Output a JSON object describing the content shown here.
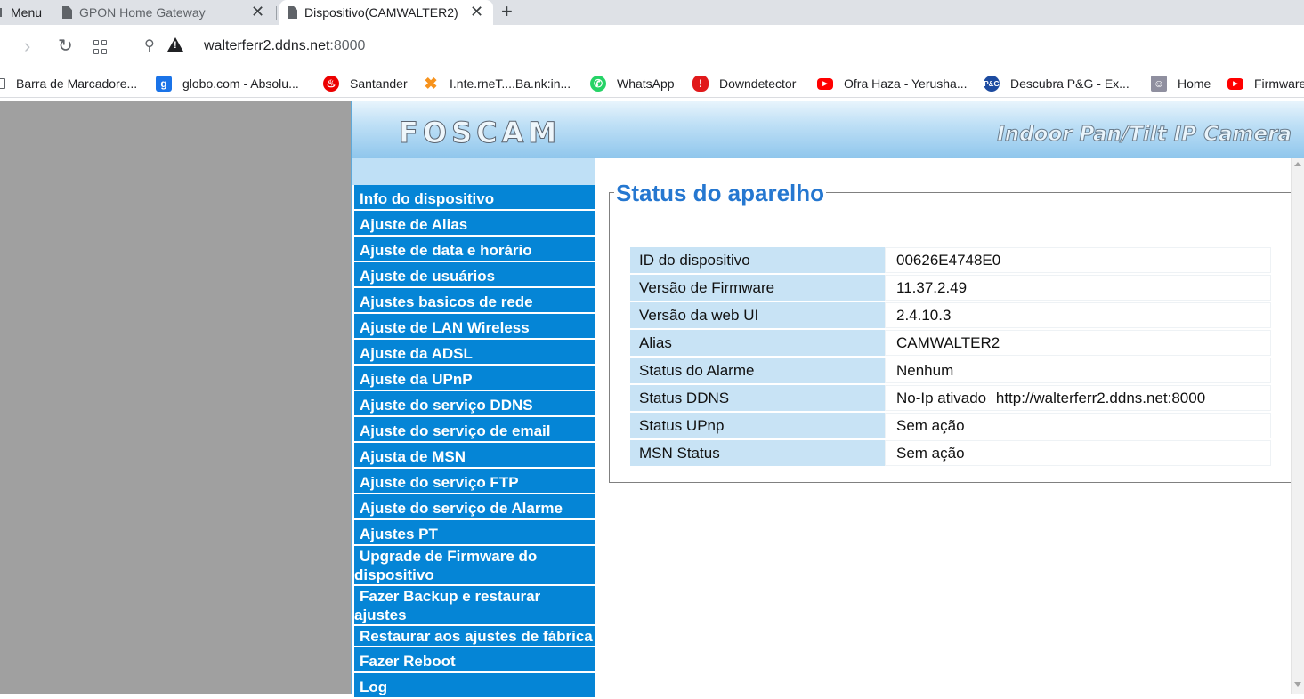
{
  "browser": {
    "menu_label": "Menu",
    "tabs": [
      {
        "title": "GPON Home Gateway",
        "active": false
      },
      {
        "title": "Dispositivo(CAMWALTER2)",
        "active": true
      }
    ],
    "close_glyph": "✕",
    "new_tab_glyph": "+",
    "url_host": "walterferr2.ddns.net",
    "url_port": ":8000",
    "bookmarks": [
      {
        "label": "Barra de Marcadore...",
        "icon": "folder-icon"
      },
      {
        "label": "globo.com - Absolu...",
        "icon": "globo-icon",
        "glyph": "g"
      },
      {
        "label": "Santander",
        "icon": "santander-icon",
        "glyph": "♨"
      },
      {
        "label": "I.nte.rneT....Ba.nk:in...",
        "icon": "x-logo-icon",
        "glyph": "✖"
      },
      {
        "label": "WhatsApp",
        "icon": "whatsapp-icon",
        "glyph": "✆"
      },
      {
        "label": "Downdetector",
        "icon": "downdetector-icon",
        "glyph": "!"
      },
      {
        "label": "Ofra Haza - Yerusha...",
        "icon": "youtube-icon",
        "glyph": "▶"
      },
      {
        "label": "Descubra P&G - Ex...",
        "icon": "pg-icon",
        "glyph": "P&G"
      },
      {
        "label": "Home",
        "icon": "home-icon",
        "glyph": "☺"
      },
      {
        "label": "Firmware",
        "icon": "youtube-icon",
        "glyph": "▶"
      }
    ]
  },
  "camera": {
    "logo": "FOSCAM",
    "model": "Indoor Pan/Tilt IP Camera",
    "nav": [
      {
        "label": "Info do dispositivo"
      },
      {
        "label": "Ajuste de Alias"
      },
      {
        "label": "Ajuste de data e horário"
      },
      {
        "label": "Ajuste de usuários"
      },
      {
        "label": "Ajustes basicos de rede"
      },
      {
        "label": "Ajuste de LAN Wireless"
      },
      {
        "label": "Ajuste da ADSL"
      },
      {
        "label": "Ajuste da UPnP"
      },
      {
        "label": "Ajuste do serviço DDNS"
      },
      {
        "label": "Ajuste do serviço de email"
      },
      {
        "label": "Ajusta de MSN"
      },
      {
        "label": "Ajuste do serviço FTP"
      },
      {
        "label": "Ajuste do serviço de Alarme"
      },
      {
        "label": "Ajustes PT"
      },
      {
        "label": "Upgrade de Firmware do dispositivo",
        "wrap": true
      },
      {
        "label": "Fazer Backup e restaurar ajustes",
        "wrap": true
      },
      {
        "label": "Restaurar aos ajustes de fábrica",
        "wrap": true
      },
      {
        "label": "Fazer Reboot"
      },
      {
        "label": "Log"
      }
    ],
    "status": {
      "title": "Status do aparelho",
      "rows": [
        {
          "key": "ID do dispositivo",
          "value": "00626E4748E0"
        },
        {
          "key": "Versão de Firmware",
          "value": "11.37.2.49"
        },
        {
          "key": "Versão da web UI",
          "value": "2.4.10.3"
        },
        {
          "key": "Alias",
          "value": "CAMWALTER2"
        },
        {
          "key": "Status do Alarme",
          "value": "Nenhum"
        },
        {
          "key": "Status DDNS",
          "value": "No-Ip ativado",
          "extra": "http://walterferr2.ddns.net:8000"
        },
        {
          "key": "Status UPnp",
          "value": "Sem ação"
        },
        {
          "key": "MSN Status",
          "value": "Sem ação"
        }
      ]
    }
  }
}
